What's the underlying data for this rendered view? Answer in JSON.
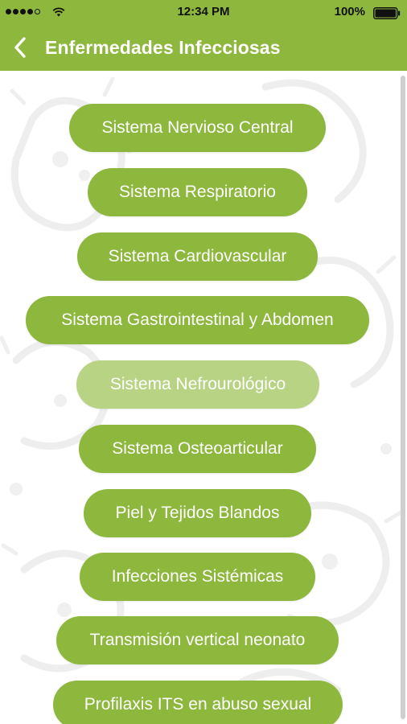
{
  "status_bar": {
    "time": "12:34 PM",
    "battery_percent": "100%",
    "signal_bars_filled": 4,
    "signal_bars_total": 5,
    "icons": [
      "signal-dots-icon",
      "wifi-icon",
      "battery-icon"
    ]
  },
  "nav": {
    "title": "Enfermedades Infecciosas",
    "back_icon": "chevron-left-icon"
  },
  "colors": {
    "primary": "#8db73d",
    "primary_light": "#b8d383",
    "text_on_primary": "#ffffff"
  },
  "menu": {
    "items": [
      {
        "label": "Sistema Nervioso Central",
        "state": "normal"
      },
      {
        "label": "Sistema Respiratorio",
        "state": "normal"
      },
      {
        "label": "Sistema Cardiovascular",
        "state": "normal"
      },
      {
        "label": "Sistema Gastrointestinal y Abdomen",
        "state": "normal"
      },
      {
        "label": "Sistema Nefrourológico",
        "state": "highlighted"
      },
      {
        "label": "Sistema Osteoarticular",
        "state": "normal"
      },
      {
        "label": "Piel y Tejidos Blandos",
        "state": "normal"
      },
      {
        "label": "Infecciones Sistémicas",
        "state": "normal"
      },
      {
        "label": "Transmisión vertical neonato",
        "state": "normal"
      },
      {
        "label": "Profilaxis ITS en abuso sexual",
        "state": "normal"
      }
    ]
  }
}
